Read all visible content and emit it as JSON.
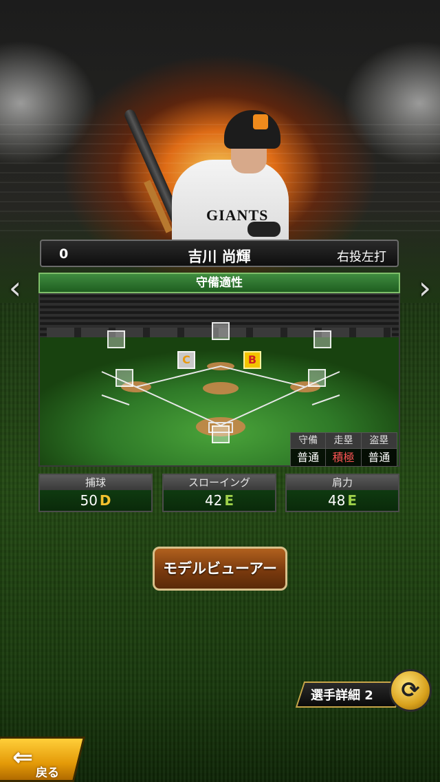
{
  "player": {
    "number": "0",
    "name": "吉川 尚輝",
    "throw_bat": "右投左打",
    "jersey_text": "GIANTS"
  },
  "panel": {
    "title": "守備適性"
  },
  "positions": [
    {
      "id": "lf",
      "label": ""
    },
    {
      "id": "cf",
      "label": ""
    },
    {
      "id": "rf",
      "label": ""
    },
    {
      "id": "ss",
      "label": "C"
    },
    {
      "id": "2b",
      "label": "B"
    },
    {
      "id": "3b",
      "label": ""
    },
    {
      "id": "1b",
      "label": ""
    },
    {
      "id": "c",
      "label": ""
    }
  ],
  "attributes": {
    "headers": [
      "守備",
      "走塁",
      "盗塁"
    ],
    "values": [
      "普通",
      "積極",
      "普通"
    ]
  },
  "stats": [
    {
      "label": "捕球",
      "value": "50",
      "grade": "D"
    },
    {
      "label": "スローイング",
      "value": "42",
      "grade": "E"
    },
    {
      "label": "肩力",
      "value": "48",
      "grade": "E"
    }
  ],
  "buttons": {
    "model_viewer": "モデルビューアー",
    "player_detail": "選手詳細 2",
    "back": "戻る"
  },
  "icons": {
    "nav_left": "chevron-left-icon",
    "nav_right": "chevron-right-icon",
    "swap": "swap-arrows-icon",
    "back": "back-arrow-icon"
  }
}
